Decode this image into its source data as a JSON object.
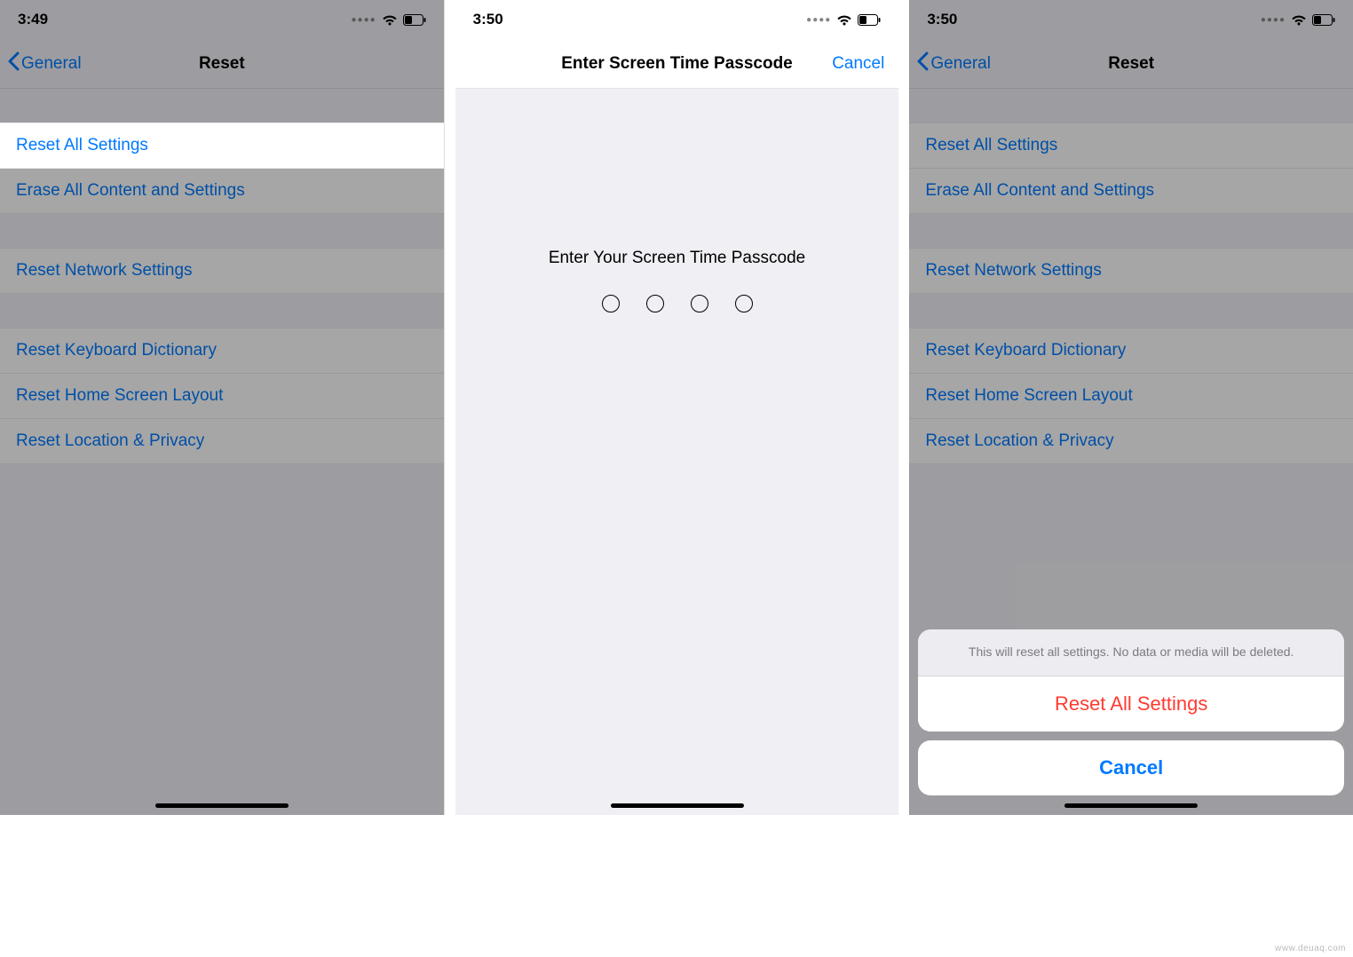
{
  "screens": {
    "left": {
      "time": "3:49",
      "back_label": "General",
      "title": "Reset",
      "groups": [
        [
          "Reset All Settings",
          "Erase All Content and Settings"
        ],
        [
          "Reset Network Settings"
        ],
        [
          "Reset Keyboard Dictionary",
          "Reset Home Screen Layout",
          "Reset Location & Privacy"
        ]
      ],
      "highlight_row": "Reset All Settings"
    },
    "middle": {
      "time": "3:50",
      "title": "Enter Screen Time Passcode",
      "cancel_label": "Cancel",
      "prompt": "Enter Your Screen Time Passcode",
      "passcode_length": 4
    },
    "right": {
      "time": "3:50",
      "back_label": "General",
      "title": "Reset",
      "groups": [
        [
          "Reset All Settings",
          "Erase All Content and Settings"
        ],
        [
          "Reset Network Settings"
        ],
        [
          "Reset Keyboard Dictionary",
          "Reset Home Screen Layout",
          "Reset Location & Privacy"
        ]
      ],
      "actionsheet": {
        "message": "This will reset all settings. No data or media will be deleted.",
        "destructive": "Reset All Settings",
        "cancel": "Cancel"
      }
    }
  },
  "watermark": "www.deuaq.com"
}
